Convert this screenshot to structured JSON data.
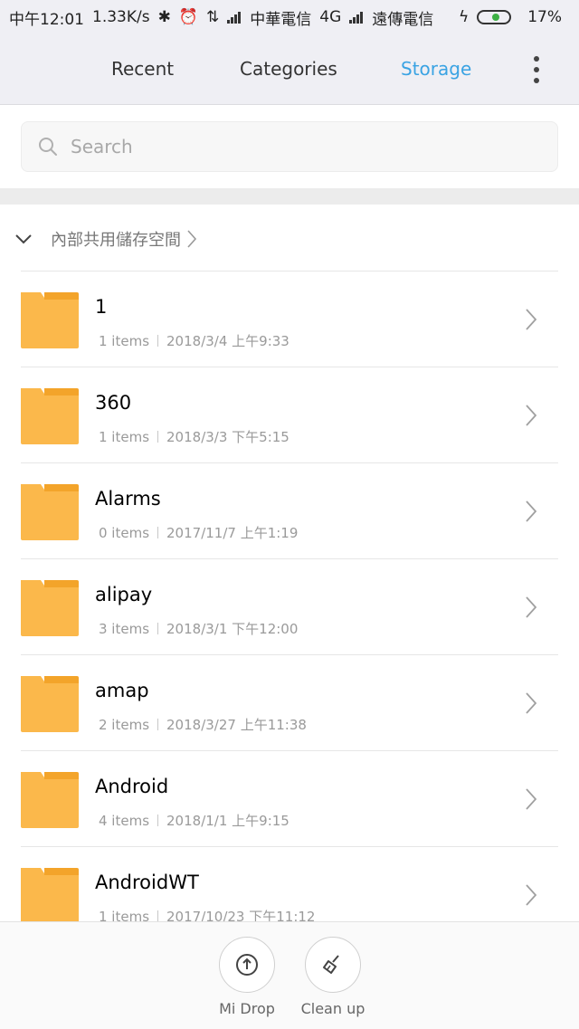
{
  "status_bar": {
    "time": "中午12:01",
    "speed": "1.33K/s",
    "carrier1": "中華電信",
    "network": "4G",
    "carrier2": "遠傳電信",
    "battery": "17%",
    "battery_level": 0.17
  },
  "tabs": [
    {
      "label": "Recent"
    },
    {
      "label": "Categories"
    },
    {
      "label": "Storage",
      "active": true
    }
  ],
  "search": {
    "placeholder": "Search"
  },
  "breadcrumb": {
    "path": "內部共用儲存空間"
  },
  "folders": [
    {
      "name": "1",
      "items": "1 items",
      "date": "2018/3/4 上午9:33"
    },
    {
      "name": "360",
      "items": "1 items",
      "date": "2018/3/3 下午5:15"
    },
    {
      "name": "Alarms",
      "items": "0 items",
      "date": "2017/11/7 上午1:19"
    },
    {
      "name": "alipay",
      "items": "3 items",
      "date": "2018/3/1 下午12:00"
    },
    {
      "name": "amap",
      "items": "2 items",
      "date": "2018/3/27 上午11:38"
    },
    {
      "name": "Android",
      "items": "4 items",
      "date": "2018/1/1 上午9:15"
    },
    {
      "name": "AndroidWT",
      "items": "1 items",
      "date": "2017/10/23 下午11:12"
    }
  ],
  "bottom": {
    "mi_drop": "Mi Drop",
    "clean_up": "Clean up"
  },
  "colors": {
    "accent": "#3aa3e3",
    "folder": "#fbb84b",
    "folder_tab": "#f3a42a"
  }
}
